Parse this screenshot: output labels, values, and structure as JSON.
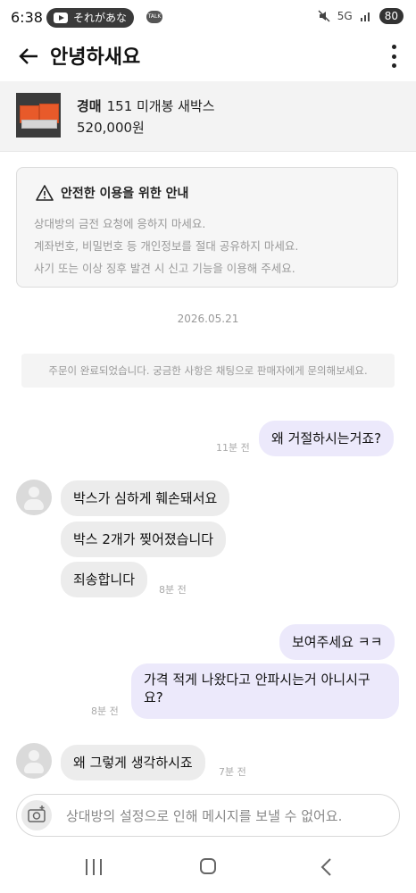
{
  "status_bar": {
    "time": "6:38",
    "notification_text": "それがあな",
    "battery": "80",
    "network": "5G"
  },
  "header": {
    "title": "안녕하새요"
  },
  "product": {
    "tag": "경매",
    "name": "151 미개봉 새박스",
    "price": "520,000원"
  },
  "notice": {
    "title": "안전한 이용을 위한 안내",
    "lines": [
      "상대방의 금전 요청에 응하지 마세요.",
      "계좌번호, 비밀번호 등 개인정보를 절대 공유하지 마세요.",
      "사기 또는 이상 징후 발견 시 신고 기능을 이용해 주세요."
    ]
  },
  "chat": {
    "date": "2026.05.21",
    "system_message": "주문이 완료되었습니다. 궁금한 사항은 채팅으로 판매자에게 문의해보세요.",
    "messages": [
      {
        "side": "mine",
        "text": "왜 거절하시는거죠?",
        "time": "11분 전"
      },
      {
        "side": "theirs",
        "text": "박스가 심하게 훼손돼서요"
      },
      {
        "side": "theirs",
        "text": "박스 2개가 찢어졌습니다"
      },
      {
        "side": "theirs",
        "text": "죄송합니다",
        "time": "8분 전"
      },
      {
        "side": "mine",
        "text": "보여주세요 ㅋㅋ"
      },
      {
        "side": "mine",
        "text_line1": "가격 적게 나왔다고 안파시는거 아니시구",
        "text_line2": "요?",
        "time": "8분 전"
      },
      {
        "side": "theirs",
        "text": "왜 그렇게 생각하시죠",
        "time": "7분 전"
      }
    ]
  },
  "input": {
    "placeholder": "상대방의 설정으로 인해 메시지를 보낼 수 없어요."
  },
  "colors": {
    "my_bubble": "#ece9fb",
    "their_bubble": "#ececec",
    "accent": "#6b4ce6"
  }
}
